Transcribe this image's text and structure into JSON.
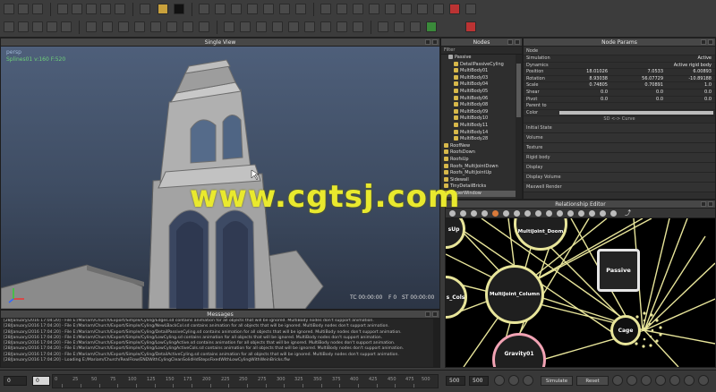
{
  "viewport": {
    "title": "Single View",
    "camera": "persp",
    "fps_info": "Splines01 v:160 F:520",
    "tc": "TC 00:00:00",
    "frame": "F 0",
    "st": "ST 00:00:00"
  },
  "nodes": {
    "title": "Nodes",
    "filter_label": "Filter",
    "items": [
      {
        "label": "Passive",
        "indent": 1
      },
      {
        "label": "DetailPassiveCyling",
        "indent": 2
      },
      {
        "label": "MultiBody01",
        "indent": 2
      },
      {
        "label": "MultiBody03",
        "indent": 2
      },
      {
        "label": "MultiBody04",
        "indent": 2
      },
      {
        "label": "MultiBody05",
        "indent": 2
      },
      {
        "label": "MultiBody06",
        "indent": 2
      },
      {
        "label": "MultiBody08",
        "indent": 2
      },
      {
        "label": "MultiBody09",
        "indent": 2
      },
      {
        "label": "MultiBody10",
        "indent": 2
      },
      {
        "label": "MultiBody11",
        "indent": 2
      },
      {
        "label": "MultiBody14",
        "indent": 2
      },
      {
        "label": "MultiBody28",
        "indent": 2
      },
      {
        "label": "RoofNew",
        "indent": 0
      },
      {
        "label": "RoofsDown",
        "indent": 0
      },
      {
        "label": "RoofsUp",
        "indent": 0
      },
      {
        "label": "Roofs_MultiJointDown",
        "indent": 0
      },
      {
        "label": "Roofs_MultiJointUp",
        "indent": 0
      },
      {
        "label": "Sidewall",
        "indent": 0
      },
      {
        "label": "TinyDetailBricks",
        "indent": 0
      },
      {
        "label": "UpperWindow",
        "indent": 0
      }
    ]
  },
  "params": {
    "title": "Node Params",
    "node_label": "Node",
    "simulation_label": "Simulation",
    "simulation_value": "Active",
    "dynamics_label": "Dynamics",
    "dynamics_value": "Active rigid body",
    "rows": [
      {
        "label": "Position",
        "a": "18.01026",
        "b": "7.0533",
        "c": "6.00893"
      },
      {
        "label": "Rotation",
        "a": "8.93038",
        "b": "56.07729",
        "c": "-10.89188"
      },
      {
        "label": "Scale",
        "a": "0.74805",
        "b": "0.70891",
        "c": "1.0"
      },
      {
        "label": "Shear",
        "a": "0.0",
        "b": "0.0",
        "c": "0.0"
      },
      {
        "label": "Pivot",
        "a": "0.0",
        "b": "0.0",
        "c": "0.0"
      }
    ],
    "parent_label": "Parent to",
    "color_label": "Color",
    "sd_curve": "SD <-> Curve",
    "sections": [
      "Initial State",
      "Volume",
      "Texture",
      "Rigid body",
      "Display",
      "Display Volume",
      "Maxwell Render"
    ]
  },
  "relationship": {
    "title": "Relationship Editor",
    "nodes": {
      "sup": "sUp",
      "multijoint_doom": "MultiJoint_Doom",
      "passive": "Passive",
      "s_cols": "s_Cols",
      "multijoint_column": "MultiJoint_Column",
      "cage": "Cage",
      "gravity": "Gravity01"
    }
  },
  "messages": {
    "title": "Messages",
    "lines": [
      "[28/January/2016 17:04:20] - File E:/Mariam/Church/Export/Simple/Cyling/Edges.sd contains animation for all objects that will be ignored. MultiBody nodes don't support animation.",
      "[28/January/2016 17:04:20] - File E:/Mariam/Church/Export/Simple/Cyling/NewLBackCol.sd contains animation for all objects that will be ignored. MultiBody nodes don't support animation.",
      "[28/January/2016 17:04:20] - File E:/Mariam/Church/Export/Simple/Cyling/DetailPassiveCyling.sd contains animation for all objects that will be ignored. MultiBody nodes don't support animation.",
      "[28/January/2016 17:04:20] - File E:/Mariam/Church/Export/Simple/Cyling/LowCyling.sd contains animation for all objects that will be ignored. MultiBody nodes don't support animation.",
      "[28/January/2016 17:04:20] - File E:/Mariam/Church/Export/Simple/Cyling/LowCylingActive.sd contains animation for all objects that will be ignored. MultiBody nodes don't support animation.",
      "[28/January/2016 17:04:20] - File E:/Mariam/Church/Export/Simple/Cyling/LowCylingActiveCols.sd contains animation for all objects that will be ignored. MultiBody nodes don't support animation.",
      "[28/January/2016 17:04:20] - File E:/Mariam/Church/Export/Simple/Cyling/DetailActiveCyling.sd contains animation for all objects that will be ignored. MultiBody nodes don't support animation.",
      "[28/January/2016 17:04:20] - Loading E:/Mariam/Church/RealFlow/ENDWithCylingCleanSolidHdStepsFixedWithLowCylingWithWeinBricks.flw"
    ]
  },
  "timeline": {
    "current_frame": "0",
    "start": "0",
    "ticks": [
      "0",
      "25",
      "50",
      "75",
      "100",
      "125",
      "150",
      "175",
      "200",
      "225",
      "250",
      "275",
      "300",
      "325",
      "350",
      "375",
      "400",
      "425",
      "450",
      "475",
      "500"
    ],
    "range_a": "500",
    "range_b": "500",
    "simulate_label": "Simulate",
    "reset_label": "Reset"
  },
  "watermark": "www.cgtsj.com",
  "colors": {
    "accent": "#c9a13c",
    "relationship_link": "#e8e59a",
    "vp_text": "#6fd17a",
    "watermark": "#e9e92e"
  }
}
